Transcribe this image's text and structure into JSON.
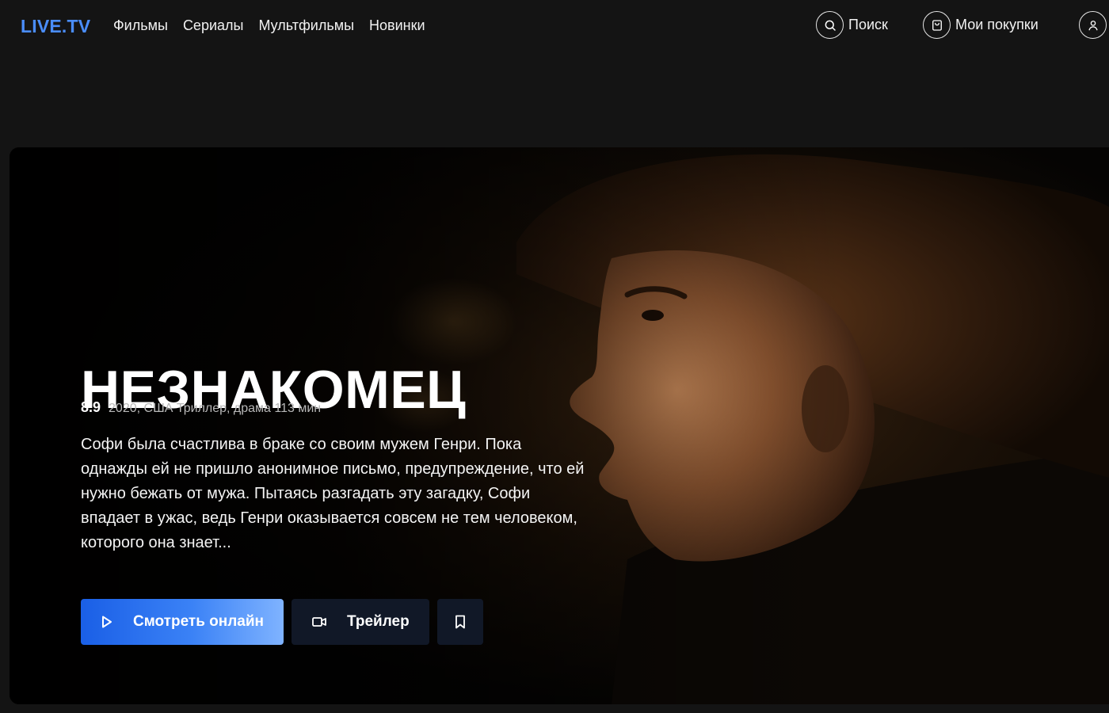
{
  "header": {
    "logo": "LIVE.TV",
    "nav": [
      {
        "label": "Фильмы"
      },
      {
        "label": "Сериалы"
      },
      {
        "label": "Мультфильмы"
      },
      {
        "label": "Новинки"
      }
    ],
    "search_label": "Поиск",
    "purchases_label": "Мои покупки",
    "icons": {
      "search": "search-icon",
      "purchases": "shopping-bag-icon",
      "profile": "user-icon"
    }
  },
  "hero": {
    "title": "НЕЗНАКОМЕЦ",
    "rating": "8.9",
    "info": "2020, США Триллер, драма 113 мин",
    "description": "Софи была счастлива в браке со своим мужем Генри. Пока однажды ей не пришло анонимное письмо, предупреждение, что ей нужно бежать от мужа. Пытаясь разгадать эту загадку, Софи впадает в ужас, ведь Генри оказывается совсем не тем человеком, которого она знает...",
    "buttons": {
      "watch": "Смотреть онлайн",
      "trailer": "Трейлер"
    },
    "icons": {
      "watch": "play-icon",
      "trailer": "video-camera-icon",
      "bookmark": "bookmark-icon"
    }
  },
  "colors": {
    "background": "#141414",
    "accent": "#4a8dfb",
    "button_primary_start": "#1a5fe6",
    "button_primary_end": "#7fb3ff",
    "button_secondary": "#111827"
  }
}
